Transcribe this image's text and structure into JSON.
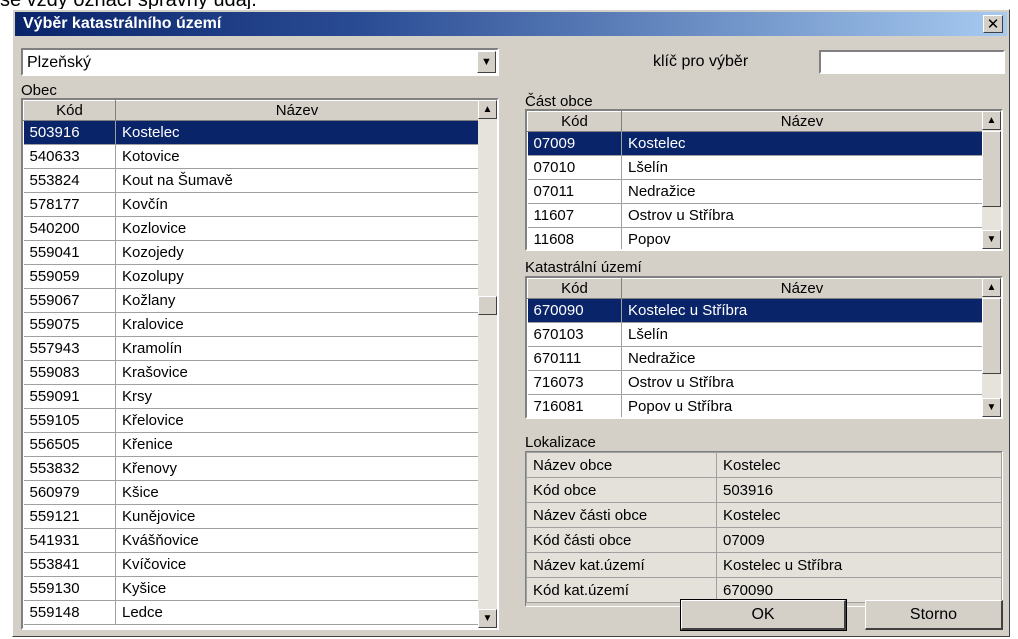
{
  "background_text": "se vždy označí správný údaj.",
  "dialog": {
    "title": "Výběr katastrálního území",
    "close_glyph": "✕"
  },
  "region_combo": {
    "value": "Plzeňský"
  },
  "key_label": "klíč pro výběr",
  "key_input": {
    "value": ""
  },
  "obec": {
    "label": "Obec",
    "columns": [
      "Kód",
      "Název"
    ],
    "selected_index": 0,
    "rows": [
      [
        "503916",
        "Kostelec"
      ],
      [
        "540633",
        "Kotovice"
      ],
      [
        "553824",
        "Kout na Šumavě"
      ],
      [
        "578177",
        "Kovčín"
      ],
      [
        "540200",
        "Kozlovice"
      ],
      [
        "559041",
        "Kozojedy"
      ],
      [
        "559059",
        "Kozolupy"
      ],
      [
        "559067",
        "Kožlany"
      ],
      [
        "559075",
        "Kralovice"
      ],
      [
        "557943",
        "Kramolín"
      ],
      [
        "559083",
        "Krašovice"
      ],
      [
        "559091",
        "Krsy"
      ],
      [
        "559105",
        "Křelovice"
      ],
      [
        "556505",
        "Křenice"
      ],
      [
        "553832",
        "Křenovy"
      ],
      [
        "560979",
        "Kšice"
      ],
      [
        "559121",
        "Kunějovice"
      ],
      [
        "541931",
        "Kvášňovice"
      ],
      [
        "553841",
        "Kvíčovice"
      ],
      [
        "559130",
        "Kyšice"
      ],
      [
        "559148",
        "Ledce"
      ]
    ]
  },
  "cast_obce": {
    "label": "Část obce",
    "columns": [
      "Kód",
      "Název"
    ],
    "selected_index": 0,
    "rows": [
      [
        "07009",
        "Kostelec"
      ],
      [
        "07010",
        "Lšelín"
      ],
      [
        "07011",
        "Nedražice"
      ],
      [
        "11607",
        "Ostrov u Stříbra"
      ],
      [
        "11608",
        "Popov"
      ]
    ]
  },
  "katastralni_uzemi": {
    "label": "Katastrální území",
    "columns": [
      "Kód",
      "Název"
    ],
    "selected_index": 0,
    "rows": [
      [
        "670090",
        "Kostelec u Stříbra"
      ],
      [
        "670103",
        "Lšelín"
      ],
      [
        "670111",
        "Nedražice"
      ],
      [
        "716073",
        "Ostrov u Stříbra"
      ],
      [
        "716081",
        "Popov u Stříbra"
      ]
    ]
  },
  "lokalizace": {
    "label": "Lokalizace",
    "rows": [
      [
        "Název obce",
        "Kostelec"
      ],
      [
        "Kód obce",
        "503916"
      ],
      [
        "Název části obce",
        "Kostelec"
      ],
      [
        "Kód části obce",
        "07009"
      ],
      [
        "Název kat.území",
        "Kostelec u Stříbra"
      ],
      [
        "Kód kat.území",
        "670090"
      ]
    ]
  },
  "buttons": {
    "ok": "OK",
    "cancel": "Storno"
  },
  "icons": {
    "up": "▲",
    "down": "▼"
  },
  "colors": {
    "selection": "#0a246a",
    "title_start": "#0a246a",
    "title_end": "#a6caf0",
    "face": "#d4d0c8"
  }
}
